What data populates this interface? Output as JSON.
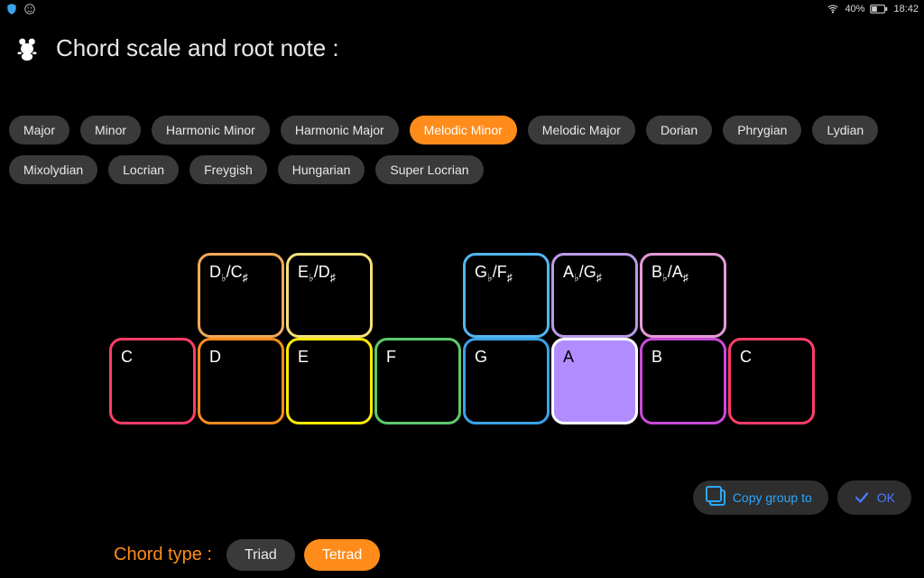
{
  "statusbar": {
    "battery_text": "40%",
    "time": "18:42"
  },
  "header": {
    "title": "Chord scale and root note :"
  },
  "scales": [
    {
      "label": "Major",
      "active": false
    },
    {
      "label": "Minor",
      "active": false
    },
    {
      "label": "Harmonic Minor",
      "active": false
    },
    {
      "label": "Harmonic Major",
      "active": false
    },
    {
      "label": "Melodic Minor",
      "active": true
    },
    {
      "label": "Melodic Major",
      "active": false
    },
    {
      "label": "Dorian",
      "active": false
    },
    {
      "label": "Phrygian",
      "active": false
    },
    {
      "label": "Lydian",
      "active": false
    },
    {
      "label": "Mixolydian",
      "active": false
    },
    {
      "label": "Locrian",
      "active": false
    },
    {
      "label": "Freygish",
      "active": false
    },
    {
      "label": "Hungarian",
      "active": false
    },
    {
      "label": "Super Locrian",
      "active": false
    }
  ],
  "keys_top": [
    {
      "spacer": true
    },
    {
      "label": "D♭/C♯",
      "color": "#f0a95a",
      "selected": false
    },
    {
      "label": "E♭/D♯",
      "color": "#f5e17a",
      "selected": false
    },
    {
      "spacer": true
    },
    {
      "label": "G♭/F♯",
      "color": "#54b6ef",
      "selected": false
    },
    {
      "label": "A♭/G♯",
      "color": "#b99be8",
      "selected": false
    },
    {
      "label": "B♭/A♯",
      "color": "#e59ad9",
      "selected": false
    },
    {
      "spacer": true
    }
  ],
  "keys_bottom": [
    {
      "label": "C",
      "color": "#ff3d6a",
      "selected": false
    },
    {
      "label": "D",
      "color": "#ff8c1a",
      "selected": false
    },
    {
      "label": "E",
      "color": "#ffea00",
      "selected": false
    },
    {
      "label": "F",
      "color": "#5cc96b",
      "selected": false
    },
    {
      "label": "G",
      "color": "#3aa3e8",
      "selected": false
    },
    {
      "label": "A",
      "color": "#ffffff",
      "selected": true
    },
    {
      "label": "B",
      "color": "#c94ad9",
      "selected": false
    },
    {
      "label": "C",
      "color": "#ff3d6a",
      "selected": false
    }
  ],
  "chord_type": {
    "label": "Chord type :",
    "options": [
      {
        "label": "Triad",
        "active": false
      },
      {
        "label": "Tetrad",
        "active": true
      }
    ]
  },
  "actions": {
    "copy_label": "Copy group to",
    "ok_label": "OK"
  }
}
